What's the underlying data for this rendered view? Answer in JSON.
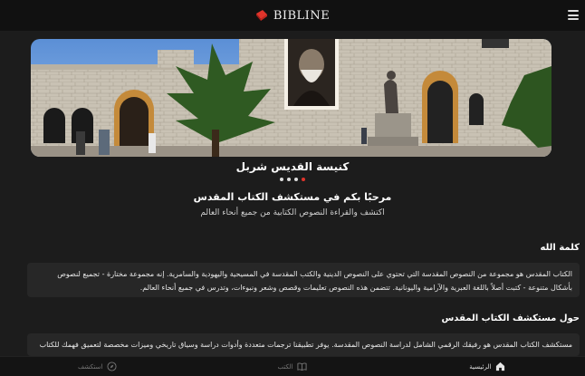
{
  "header": {
    "brand_name": "BIBLINE"
  },
  "banner": {
    "title": "كنيسة القديس شربل",
    "slide_count": 4,
    "active_slide": 1
  },
  "intro": {
    "welcome": "مرحبًا بكم في مستكشف الكتاب المقدس",
    "subtitle": "اكتشف والقراءة النصوص الكتابية من جميع أنحاء العالم"
  },
  "sections": [
    {
      "title": "كلمة الله",
      "body": "الكتاب المقدس هو مجموعة من النصوص المقدسة التي تحتوي على النصوص الدينية والكتب المقدسة في المسيحية واليهودية والسامرية. إنه مجموعة مختارة - تجميع لنصوص بأشكال متنوعة - كتبت أصلاً باللغة العبرية والآرامية واليونانية. تتضمن هذه النصوص تعليمات وقصص وشعر ونبوءات، وتدرس في جميع أنحاء العالم."
    },
    {
      "title": "حول مستكشف الكتاب المقدس",
      "body": "مستكشف الكتاب المقدس هو رفيقك الرقمي الشامل لدراسة النصوص المقدسة. يوفر تطبيقنا ترجمات متعددة وأدوات دراسة وسياق تاريخي وميزات مخصصة لتعميق فهمك للكتاب"
    }
  ],
  "bottom_nav": [
    {
      "label": "الرئيسية",
      "icon": "home-icon",
      "active": true
    },
    {
      "label": "الكتب",
      "icon": "book-icon",
      "active": false
    },
    {
      "label": "استكشف",
      "icon": "compass-icon",
      "active": false
    }
  ],
  "colors": {
    "background": "#1c1c1c",
    "card": "#272727",
    "accent": "#e0342b"
  }
}
